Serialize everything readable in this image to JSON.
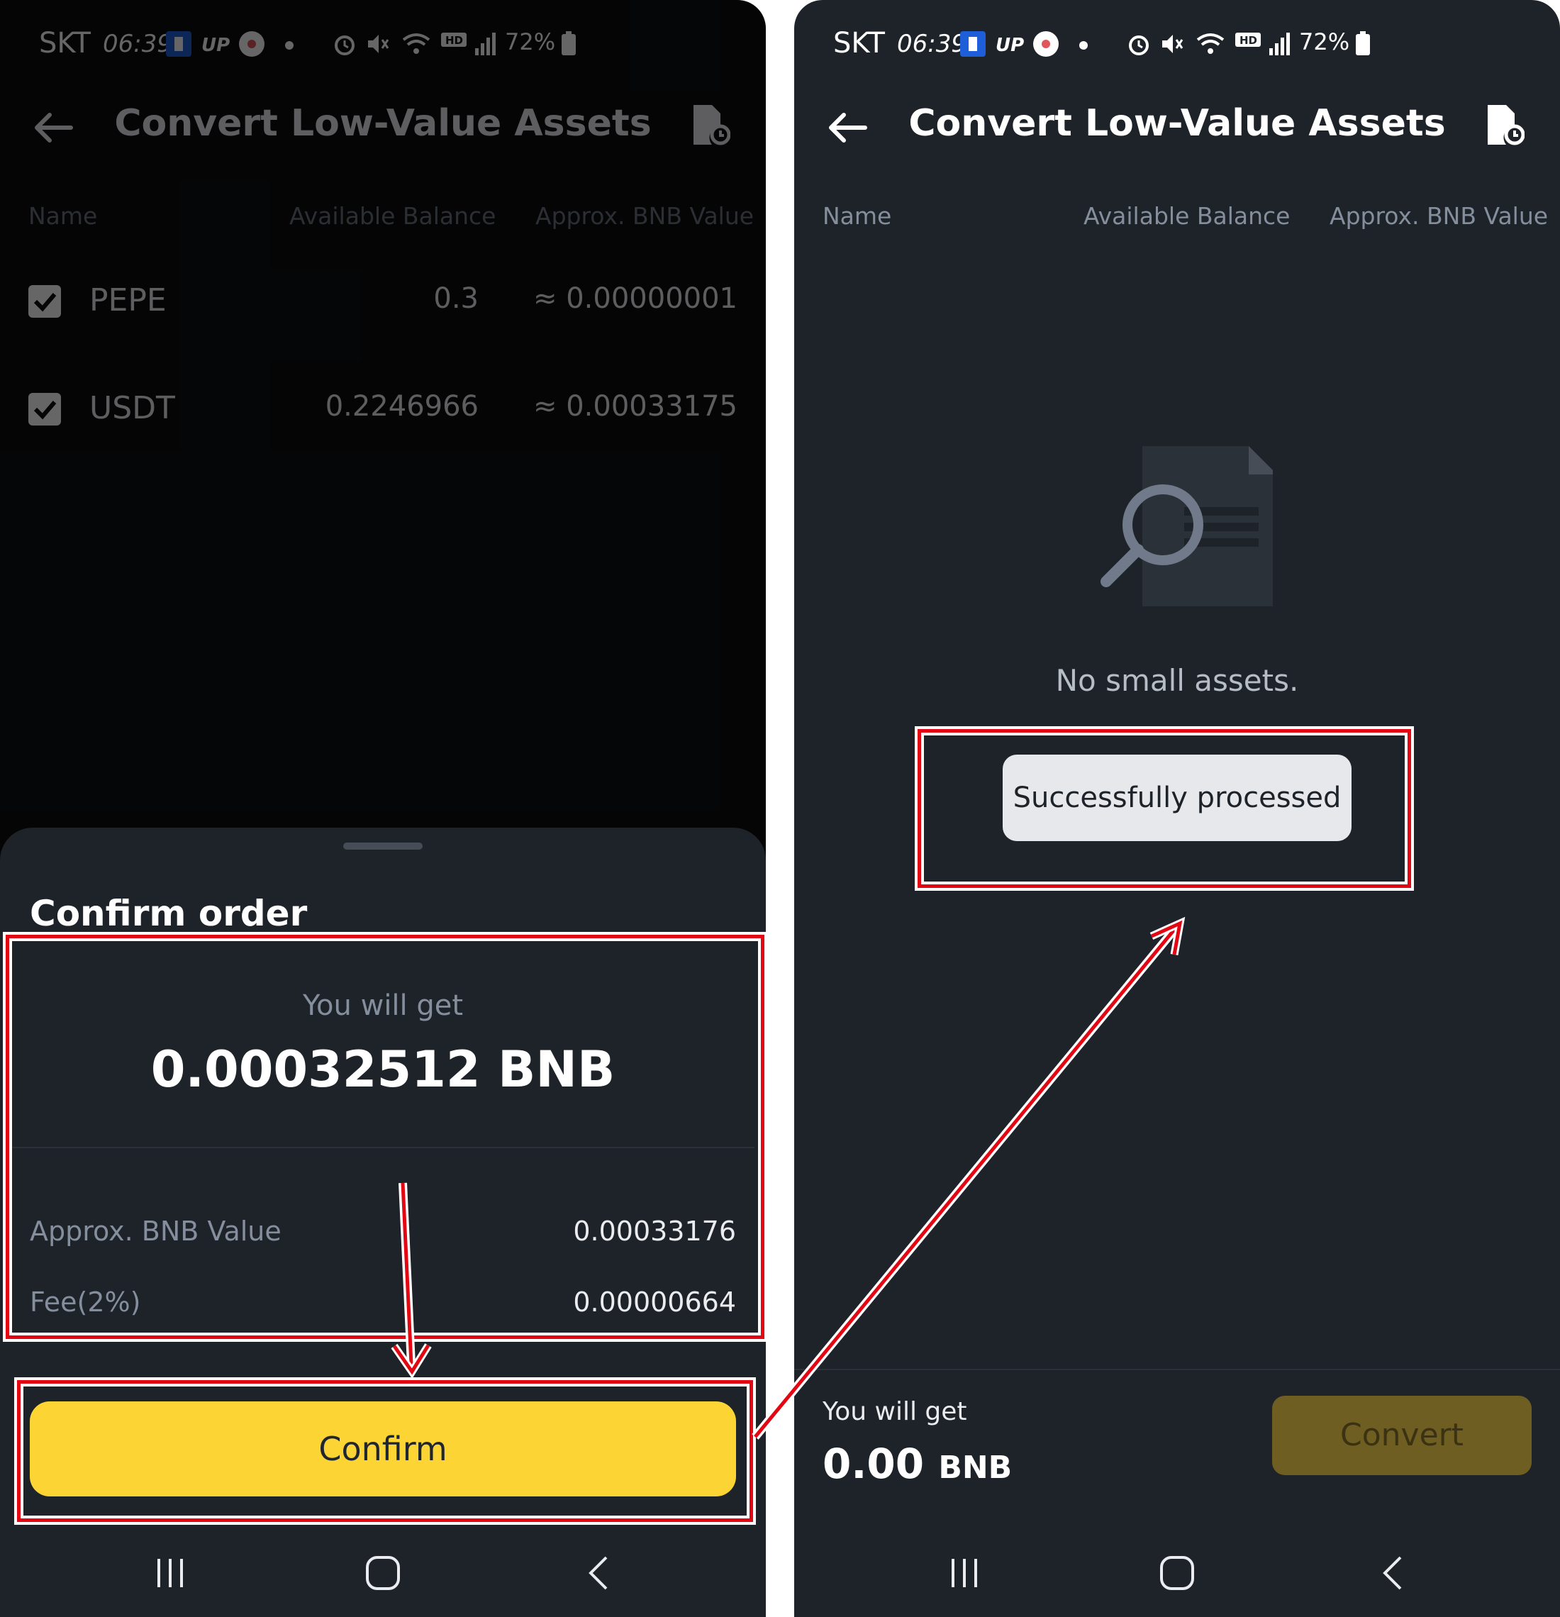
{
  "status_bar": {
    "carrier": "SKT",
    "time": "06:39",
    "battery": "72%"
  },
  "left_screen": {
    "title": "Convert Low-Value Assets",
    "columns": [
      "Name",
      "Available Balance",
      "Approx. BNB Value"
    ],
    "assets": [
      {
        "name": "PEPE",
        "balance": "0.3",
        "bnb_value": "≈ 0.00000001",
        "checked": true
      },
      {
        "name": "USDT",
        "balance": "0.2246966",
        "bnb_value": "≈ 0.00033175",
        "checked": true
      }
    ],
    "sheet": {
      "title": "Confirm order",
      "you_will_get_label": "You will get",
      "amount": "0.00032512 BNB",
      "approx_label": "Approx. BNB Value",
      "approx_value": "0.00033176",
      "fee_label": "Fee(2%)",
      "fee_value": "0.00000664",
      "confirm_label": "Confirm"
    }
  },
  "right_screen": {
    "title": "Convert Low-Value Assets",
    "columns": [
      "Name",
      "Available Balance",
      "Approx. BNB Value"
    ],
    "empty_text": "No small assets.",
    "toast": "Successfully processed",
    "you_will_get_label": "You will get",
    "amount_value": "0.00",
    "amount_unit": "BNB",
    "convert_label": "Convert"
  },
  "colors": {
    "accent_yellow": "#fcd535",
    "annotation_red": "#e30613",
    "panel_bg": "#1e2329"
  }
}
